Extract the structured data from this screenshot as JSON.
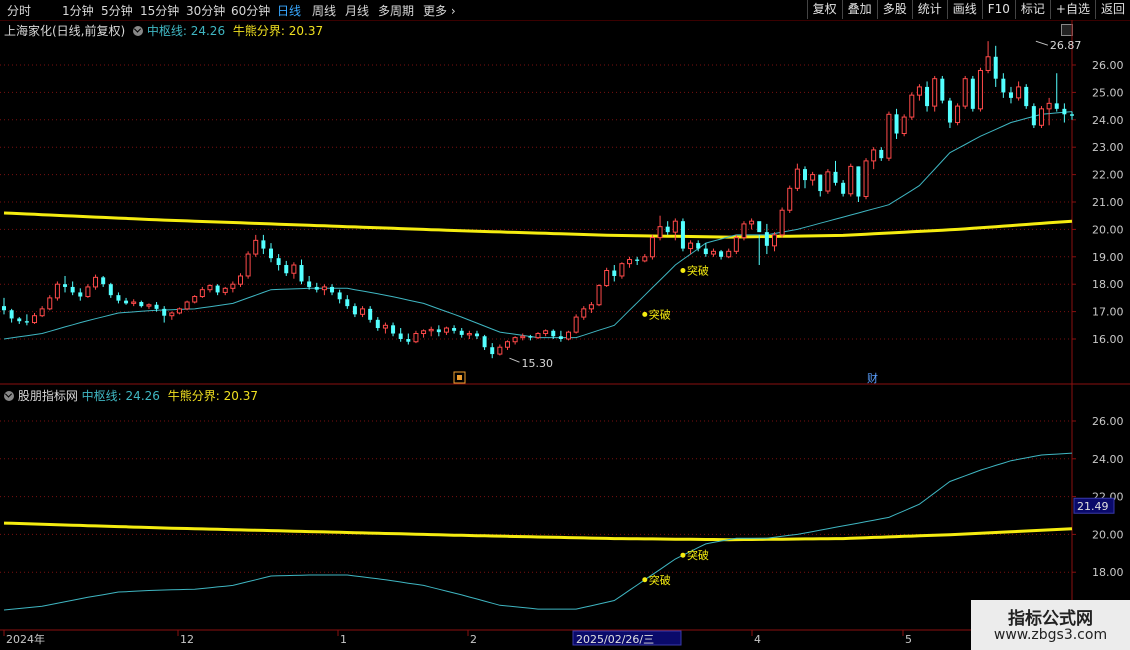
{
  "toolbar": {
    "periods": [
      "分时",
      "1分钟",
      "5分钟",
      "15分钟",
      "30分钟",
      "60分钟",
      "日线",
      "周线",
      "月线",
      "多周期",
      "更多"
    ],
    "active_index": 6,
    "right_buttons": [
      "复权",
      "叠加",
      "多股",
      "统计",
      "画线",
      "F10",
      "标记",
      "+自选",
      "返回"
    ]
  },
  "main_header": {
    "stock_title": "上海家化(日线,前复权)",
    "line1_label": "中枢线:",
    "line1_value": "24.26",
    "line2_label": "牛熊分界:",
    "line2_value": "20.37"
  },
  "sub_header": {
    "indicator_name": "股朋指标网",
    "line1_label": "中枢线:",
    "line1_value": "24.26",
    "line2_label": "牛熊分界:",
    "line2_value": "20.37"
  },
  "main_axis_ticks": [
    "26.00",
    "25.00",
    "24.00",
    "23.00",
    "22.00",
    "21.00",
    "20.00",
    "19.00",
    "18.00",
    "17.00",
    "16.00"
  ],
  "sub_axis_ticks": [
    "26.00",
    "24.00",
    "22.00",
    "20.00",
    "18.00"
  ],
  "sub_current_value": "21.49",
  "price_high_label": "26.87",
  "price_low_label": "15.30",
  "signal_label": "突破",
  "finance_marker": "财",
  "date_axis": {
    "labels": [
      "2024年",
      "12",
      "1",
      "2",
      "4",
      "5"
    ],
    "cursor_date": "2025/02/26/三"
  },
  "watermark": {
    "title": "指标公式网",
    "url": "www.zbgs3.com"
  },
  "colors": {
    "up": "#ff4a4a",
    "down": "#54ffff",
    "pivot_line": "#3fb6c2",
    "bull_bear_line": "#f5ec10",
    "grid": "#7a1010"
  },
  "chart_data": {
    "type": "candlestick",
    "candles": [
      [
        17.2,
        17.5,
        16.9,
        17.05
      ],
      [
        17.05,
        17.1,
        16.6,
        16.75
      ],
      [
        16.75,
        16.8,
        16.55,
        16.65
      ],
      [
        16.65,
        16.9,
        16.5,
        16.6
      ],
      [
        16.6,
        16.95,
        16.55,
        16.85
      ],
      [
        16.85,
        17.2,
        16.8,
        17.1
      ],
      [
        17.1,
        17.6,
        17.05,
        17.5
      ],
      [
        17.5,
        18.1,
        17.4,
        18.0
      ],
      [
        18.0,
        18.3,
        17.7,
        17.9
      ],
      [
        17.9,
        18.1,
        17.6,
        17.7
      ],
      [
        17.7,
        17.85,
        17.4,
        17.55
      ],
      [
        17.55,
        18.0,
        17.5,
        17.9
      ],
      [
        17.9,
        18.35,
        17.8,
        18.25
      ],
      [
        18.25,
        18.3,
        17.9,
        18.0
      ],
      [
        18.0,
        18.05,
        17.5,
        17.6
      ],
      [
        17.6,
        17.7,
        17.3,
        17.4
      ],
      [
        17.4,
        17.5,
        17.25,
        17.3
      ],
      [
        17.3,
        17.45,
        17.2,
        17.35
      ],
      [
        17.35,
        17.4,
        17.15,
        17.2
      ],
      [
        17.2,
        17.3,
        17.1,
        17.25
      ],
      [
        17.25,
        17.35,
        17.0,
        17.1
      ],
      [
        17.1,
        17.2,
        16.6,
        16.85
      ],
      [
        16.85,
        17.0,
        16.7,
        16.95
      ],
      [
        16.95,
        17.15,
        16.9,
        17.1
      ],
      [
        17.1,
        17.4,
        17.05,
        17.35
      ],
      [
        17.35,
        17.6,
        17.3,
        17.55
      ],
      [
        17.55,
        17.9,
        17.5,
        17.8
      ],
      [
        17.8,
        18.0,
        17.7,
        17.95
      ],
      [
        17.95,
        18.0,
        17.6,
        17.7
      ],
      [
        17.7,
        17.9,
        17.6,
        17.85
      ],
      [
        17.85,
        18.1,
        17.7,
        18.0
      ],
      [
        18.0,
        18.4,
        17.9,
        18.3
      ],
      [
        18.3,
        19.2,
        18.2,
        19.1
      ],
      [
        19.1,
        19.8,
        19.0,
        19.6
      ],
      [
        19.6,
        19.8,
        19.1,
        19.3
      ],
      [
        19.3,
        19.5,
        18.8,
        18.95
      ],
      [
        18.95,
        19.1,
        18.5,
        18.7
      ],
      [
        18.7,
        18.85,
        18.3,
        18.4
      ],
      [
        18.4,
        18.8,
        18.2,
        18.7
      ],
      [
        18.7,
        18.9,
        18.0,
        18.1
      ],
      [
        18.1,
        18.3,
        17.8,
        17.9
      ],
      [
        17.9,
        18.05,
        17.7,
        17.8
      ],
      [
        17.8,
        18.0,
        17.6,
        17.9
      ],
      [
        17.9,
        18.0,
        17.6,
        17.7
      ],
      [
        17.7,
        17.8,
        17.3,
        17.45
      ],
      [
        17.45,
        17.6,
        17.1,
        17.2
      ],
      [
        17.2,
        17.3,
        16.8,
        16.9
      ],
      [
        16.9,
        17.2,
        16.8,
        17.1
      ],
      [
        17.1,
        17.2,
        16.6,
        16.7
      ],
      [
        16.7,
        16.8,
        16.3,
        16.4
      ],
      [
        16.4,
        16.6,
        16.2,
        16.5
      ],
      [
        16.5,
        16.6,
        16.1,
        16.2
      ],
      [
        16.2,
        16.4,
        15.9,
        16.0
      ],
      [
        16.0,
        16.2,
        15.8,
        15.9
      ],
      [
        15.9,
        16.3,
        15.85,
        16.2
      ],
      [
        16.2,
        16.35,
        16.05,
        16.3
      ],
      [
        16.3,
        16.45,
        16.1,
        16.35
      ],
      [
        16.35,
        16.5,
        16.1,
        16.25
      ],
      [
        16.25,
        16.45,
        16.15,
        16.4
      ],
      [
        16.4,
        16.5,
        16.2,
        16.3
      ],
      [
        16.3,
        16.4,
        16.05,
        16.15
      ],
      [
        16.15,
        16.3,
        16.0,
        16.2
      ],
      [
        16.2,
        16.3,
        16.0,
        16.1
      ],
      [
        16.1,
        16.15,
        15.6,
        15.7
      ],
      [
        15.7,
        15.85,
        15.3,
        15.45
      ],
      [
        15.45,
        15.8,
        15.4,
        15.7
      ],
      [
        15.7,
        15.95,
        15.6,
        15.9
      ],
      [
        15.9,
        16.1,
        15.8,
        16.05
      ],
      [
        16.05,
        16.2,
        15.95,
        16.1
      ],
      [
        16.1,
        16.15,
        15.95,
        16.05
      ],
      [
        16.05,
        16.25,
        16.0,
        16.2
      ],
      [
        16.2,
        16.35,
        16.1,
        16.3
      ],
      [
        16.3,
        16.35,
        16.0,
        16.1
      ],
      [
        16.1,
        16.3,
        15.9,
        16.0
      ],
      [
        16.0,
        16.3,
        15.95,
        16.25
      ],
      [
        16.25,
        16.9,
        16.2,
        16.8
      ],
      [
        16.8,
        17.2,
        16.7,
        17.1
      ],
      [
        17.1,
        17.35,
        16.95,
        17.25
      ],
      [
        17.25,
        18.0,
        17.2,
        17.95
      ],
      [
        17.95,
        18.6,
        17.9,
        18.5
      ],
      [
        18.5,
        18.7,
        18.1,
        18.3
      ],
      [
        18.3,
        18.8,
        18.2,
        18.75
      ],
      [
        18.75,
        19.0,
        18.6,
        18.9
      ],
      [
        18.9,
        19.0,
        18.7,
        18.85
      ],
      [
        18.85,
        19.1,
        18.8,
        19.0
      ],
      [
        19.0,
        19.8,
        18.9,
        19.7
      ],
      [
        19.7,
        20.5,
        19.6,
        20.1
      ],
      [
        20.1,
        20.3,
        19.8,
        19.9
      ],
      [
        19.9,
        20.4,
        19.6,
        20.3
      ],
      [
        20.3,
        20.4,
        19.2,
        19.3
      ],
      [
        19.3,
        19.6,
        19.1,
        19.5
      ],
      [
        19.5,
        19.6,
        19.2,
        19.3
      ],
      [
        19.3,
        19.5,
        19.0,
        19.1
      ],
      [
        19.1,
        19.3,
        19.0,
        19.2
      ],
      [
        19.2,
        19.25,
        18.9,
        19.0
      ],
      [
        19.0,
        19.3,
        18.95,
        19.2
      ],
      [
        19.2,
        19.8,
        19.1,
        19.7
      ],
      [
        19.7,
        20.3,
        19.6,
        20.2
      ],
      [
        20.2,
        20.4,
        20.0,
        20.3
      ],
      [
        20.3,
        19.8,
        18.7,
        19.9
      ],
      [
        19.9,
        20.2,
        19.1,
        19.4
      ],
      [
        19.4,
        19.9,
        19.2,
        19.8
      ],
      [
        19.8,
        20.8,
        19.7,
        20.7
      ],
      [
        20.7,
        21.6,
        20.6,
        21.5
      ],
      [
        21.5,
        22.4,
        21.4,
        22.2
      ],
      [
        22.2,
        22.3,
        21.5,
        21.8
      ],
      [
        21.8,
        22.1,
        21.6,
        22.0
      ],
      [
        22.0,
        21.9,
        21.2,
        21.4
      ],
      [
        21.4,
        22.2,
        21.3,
        22.1
      ],
      [
        22.1,
        22.5,
        21.6,
        21.7
      ],
      [
        21.7,
        21.8,
        21.2,
        21.3
      ],
      [
        21.3,
        22.4,
        21.2,
        22.3
      ],
      [
        22.3,
        22.3,
        21.0,
        21.2
      ],
      [
        21.2,
        22.6,
        21.1,
        22.5
      ],
      [
        22.5,
        23.0,
        22.2,
        22.9
      ],
      [
        22.9,
        23.0,
        22.5,
        22.6
      ],
      [
        22.6,
        24.3,
        22.5,
        24.2
      ],
      [
        24.2,
        24.4,
        23.3,
        23.5
      ],
      [
        23.5,
        24.2,
        23.4,
        24.1
      ],
      [
        24.1,
        25.0,
        24.0,
        24.9
      ],
      [
        24.9,
        25.3,
        24.7,
        25.2
      ],
      [
        25.2,
        25.4,
        24.3,
        24.5
      ],
      [
        24.5,
        25.6,
        24.3,
        25.5
      ],
      [
        25.5,
        25.6,
        24.6,
        24.7
      ],
      [
        24.7,
        24.8,
        23.7,
        23.9
      ],
      [
        23.9,
        24.6,
        23.8,
        24.5
      ],
      [
        24.5,
        25.6,
        24.4,
        25.5
      ],
      [
        25.5,
        25.6,
        24.3,
        24.4
      ],
      [
        24.4,
        25.9,
        24.3,
        25.8
      ],
      [
        25.8,
        26.87,
        25.7,
        26.3
      ],
      [
        26.3,
        26.7,
        25.2,
        25.5
      ],
      [
        25.5,
        25.7,
        24.8,
        25.0
      ],
      [
        25.0,
        25.2,
        24.6,
        24.8
      ],
      [
        24.8,
        25.4,
        24.7,
        25.2
      ],
      [
        25.2,
        25.3,
        24.4,
        24.5
      ],
      [
        24.5,
        24.6,
        23.7,
        23.8
      ],
      [
        23.8,
        24.5,
        23.7,
        24.4
      ],
      [
        24.4,
        24.8,
        23.8,
        24.6
      ],
      [
        24.6,
        25.7,
        24.3,
        24.4
      ],
      [
        24.4,
        24.6,
        23.9,
        24.2
      ],
      [
        24.2,
        24.3,
        24.0,
        24.15
      ]
    ],
    "pivot_line": [
      [
        0,
        16.0
      ],
      [
        5,
        16.2
      ],
      [
        10,
        16.6
      ],
      [
        15,
        16.95
      ],
      [
        20,
        17.05
      ],
      [
        25,
        17.1
      ],
      [
        30,
        17.3
      ],
      [
        35,
        17.8
      ],
      [
        40,
        17.85
      ],
      [
        45,
        17.85
      ],
      [
        50,
        17.6
      ],
      [
        55,
        17.3
      ],
      [
        60,
        16.8
      ],
      [
        65,
        16.25
      ],
      [
        70,
        16.05
      ],
      [
        75,
        16.05
      ],
      [
        80,
        16.5
      ],
      [
        84,
        17.6
      ],
      [
        88,
        18.7
      ],
      [
        92,
        19.5
      ],
      [
        96,
        19.8
      ],
      [
        100,
        19.8
      ],
      [
        104,
        20.0
      ],
      [
        108,
        20.3
      ],
      [
        112,
        20.6
      ],
      [
        116,
        20.9
      ],
      [
        120,
        21.6
      ],
      [
        124,
        22.8
      ],
      [
        128,
        23.4
      ],
      [
        132,
        23.9
      ],
      [
        136,
        24.2
      ],
      [
        140,
        24.3
      ],
      [
        145,
        24.26
      ]
    ],
    "bull_bear_line": [
      [
        0,
        20.6
      ],
      [
        20,
        20.35
      ],
      [
        40,
        20.15
      ],
      [
        60,
        19.95
      ],
      [
        80,
        19.78
      ],
      [
        95,
        19.72
      ],
      [
        110,
        19.78
      ],
      [
        125,
        20.0
      ],
      [
        140,
        20.3
      ],
      [
        145,
        20.37
      ]
    ],
    "signals": [
      [
        84,
        16.9
      ],
      [
        89,
        18.5
      ]
    ],
    "high_index": 135,
    "low_index": 66
  }
}
